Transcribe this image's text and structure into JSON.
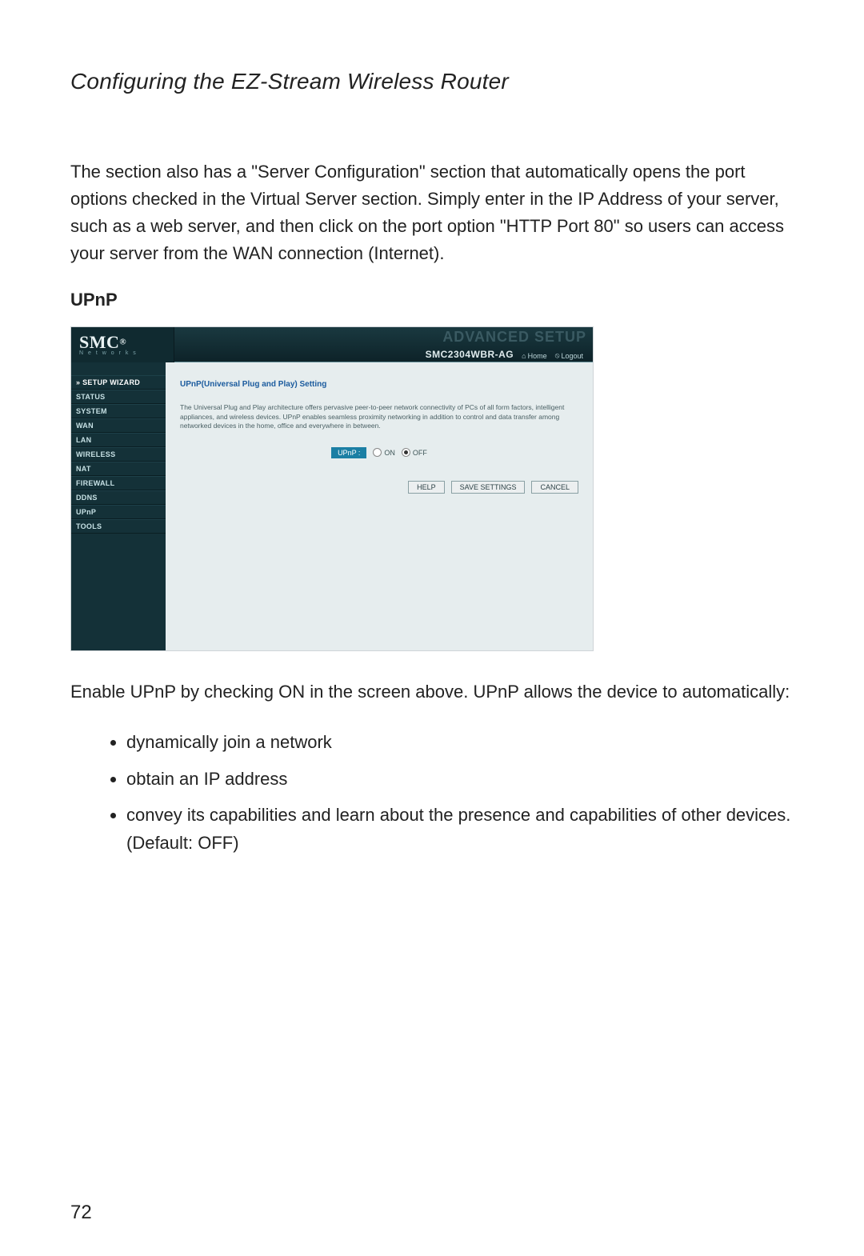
{
  "document": {
    "title": "Configuring the EZ-Stream Wireless Router",
    "intro_para": "The section also has a \"Server Configuration\" section that automatically opens the port options checked in the Virtual Server section. Simply enter in the IP Address of your server, such as a web server, and then click on the port option \"HTTP Port 80\" so users can access your server from the WAN connection (Internet).",
    "section_heading": "UPnP",
    "post_screenshot_para": "Enable UPnP by checking ON in the screen above. UPnP allows the device to automatically:",
    "bullets": [
      "dynamically join a network",
      "obtain an IP address",
      "convey its capabilities and learn about the presence and capabilities of other devices. (Default: OFF)"
    ],
    "page_number": "72"
  },
  "router": {
    "brand": "SMC",
    "brand_reg": "®",
    "brand_sub": "N e t w o r k s",
    "banner": "ADVANCED SETUP",
    "model": "SMC2304WBR-AG",
    "home_link": "Home",
    "home_icon": "⌂",
    "logout_link": "Logout",
    "logout_icon": "⦸",
    "sidebar": {
      "wizard": "» SETUP WIZARD",
      "items": [
        "STATUS",
        "SYSTEM",
        "WAN",
        "LAN",
        "WIRELESS",
        "NAT",
        "FIREWALL",
        "DDNS",
        "UPnP",
        "TOOLS"
      ]
    },
    "panel": {
      "title": "UPnP(Universal Plug and Play) Setting",
      "desc": "The Universal Plug and Play architecture offers pervasive peer-to-peer network connectivity of PCs of all form factors, intelligent appliances, and wireless devices. UPnP enables seamless proximity networking in addition to control and data transfer among networked devices in the home, office and everywhere in between.",
      "radio_label": "UPnP :",
      "on_label": "ON",
      "off_label": "OFF",
      "selected": "OFF",
      "buttons": {
        "help": "HELP",
        "save": "SAVE SETTINGS",
        "cancel": "CANCEL"
      }
    }
  }
}
